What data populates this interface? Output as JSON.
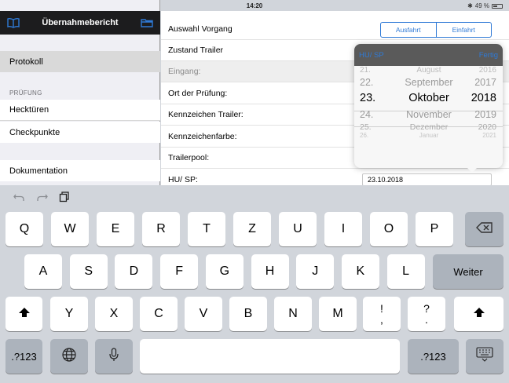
{
  "status_bar": {
    "time": "14:20",
    "battery": "49 %"
  },
  "sidebar": {
    "title": "Übernahmebericht",
    "items": {
      "protokoll": "Protokoll",
      "section": "PRÜFUNG",
      "hecktueren": "Hecktüren",
      "checkpunkte": "Checkpunkte",
      "dokumentation": "Dokumentation"
    }
  },
  "form": {
    "rows": [
      "Auswahl Vorgang",
      "Zustand Trailer",
      "Eingang:",
      "Ort der Prüfung:",
      "Kennzeichen Trailer:",
      "Kennzeichenfarbe:",
      "Trailerpool:",
      "HU/ SP:"
    ],
    "segment": {
      "ausfahrt": "Ausfahrt",
      "einfahrt": "Einfahrt"
    },
    "hu_value": "23.10.2018"
  },
  "date_picker": {
    "label": "HU/ SP",
    "done": "Fertig",
    "days": [
      "21.",
      "22.",
      "23.",
      "24.",
      "25.",
      "26."
    ],
    "months": [
      "August",
      "September",
      "Oktober",
      "November",
      "Dezember",
      "Januar"
    ],
    "years": [
      "2016",
      "2017",
      "2018",
      "2019",
      "2020",
      "2021"
    ],
    "selected_index": 2
  },
  "keyboard": {
    "row1": [
      "Q",
      "W",
      "E",
      "R",
      "T",
      "Z",
      "U",
      "I",
      "O",
      "P"
    ],
    "row2": [
      "A",
      "S",
      "D",
      "F",
      "G",
      "H",
      "J",
      "K",
      "L"
    ],
    "row3": [
      "Y",
      "X",
      "C",
      "V",
      "B",
      "N",
      "M"
    ],
    "return_label": "Weiter",
    "numbers_label": ".?123",
    "exclam": "!\n,",
    "question": "?\n."
  },
  "colors": {
    "accent": "#2f7ad6",
    "sidebar_header": "#1c1c1e"
  }
}
